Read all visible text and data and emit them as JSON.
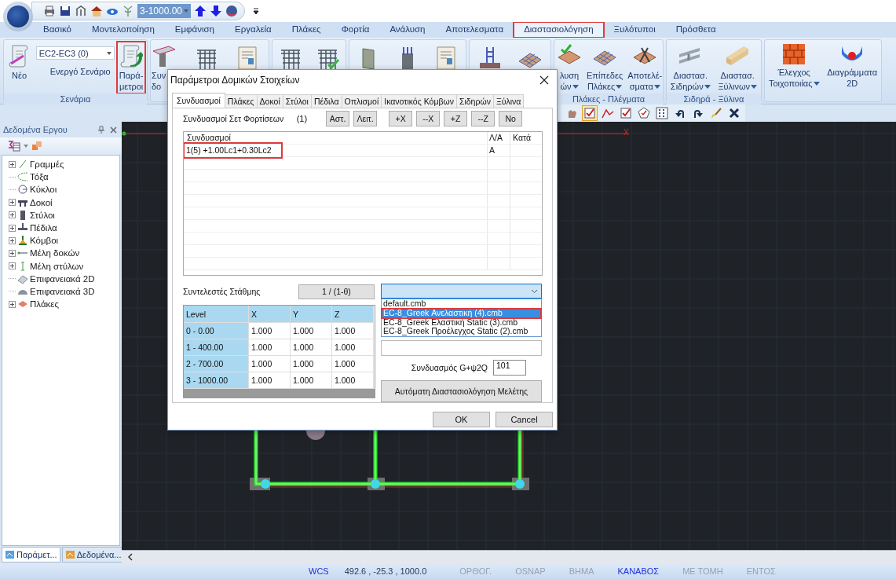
{
  "quick_access": {
    "level_combo": "3-1000.00"
  },
  "menu_tabs": [
    {
      "label": "Βασικό",
      "selected": false,
      "highlighted": false
    },
    {
      "label": "Μοντελοποίηση",
      "selected": false,
      "highlighted": false
    },
    {
      "label": "Εμφάνιση",
      "selected": false,
      "highlighted": false
    },
    {
      "label": "Εργαλεία",
      "selected": false,
      "highlighted": false
    },
    {
      "label": "Πλάκες",
      "selected": false,
      "highlighted": false
    },
    {
      "label": "Φορτία",
      "selected": false,
      "highlighted": false
    },
    {
      "label": "Ανάλυση",
      "selected": false,
      "highlighted": false
    },
    {
      "label": "Αποτελεσματα",
      "selected": false,
      "highlighted": false
    },
    {
      "label": "Διαστασιολόγηση",
      "selected": true,
      "highlighted": true
    },
    {
      "label": "Ξυλότυποι",
      "selected": false,
      "highlighted": false
    },
    {
      "label": "Πρόσθετα",
      "selected": false,
      "highlighted": false
    }
  ],
  "ribbon": {
    "groups": [
      {
        "label": "Σενάρια",
        "items": [
          {
            "kind": "large",
            "lines": [
              "Νέο"
            ],
            "dropdown": false,
            "highlighted": false
          },
          {
            "kind": "combo",
            "value": "EC2-EC3  (0)",
            "caption": "Ενεργό Σενάριο"
          },
          {
            "kind": "large",
            "lines": [
              "Παρά-",
              "μετροι"
            ],
            "dropdown": false,
            "highlighted": true
          }
        ]
      },
      {
        "items": [
          {
            "kind": "large",
            "lines": [
              "Συν",
              "δο"
            ],
            "dropdown": false,
            "highlighted": false
          },
          {
            "kind": "icon"
          },
          {
            "kind": "icon"
          }
        ]
      },
      {
        "items": [
          {
            "kind": "icon"
          },
          {
            "kind": "icon"
          }
        ]
      },
      {
        "items": [
          {
            "kind": "icon"
          },
          {
            "kind": "icon"
          },
          {
            "kind": "icon"
          }
        ]
      },
      {
        "items": [
          {
            "kind": "icon"
          },
          {
            "kind": "icon"
          }
        ]
      },
      {
        "label": "Πλάκες - Πλέγματα",
        "items": [
          {
            "kind": "large",
            "lines": [
              "λυση",
              "ών"
            ],
            "dropdown": true,
            "highlighted": false
          },
          {
            "kind": "large",
            "lines": [
              "Επίπεδες",
              "Πλάκες"
            ],
            "dropdown": true,
            "highlighted": false
          },
          {
            "kind": "large",
            "lines": [
              "Αποτελέ-",
              "σματα"
            ],
            "dropdown": true,
            "highlighted": false
          }
        ]
      },
      {
        "label": "Σιδηρά - Ξύλινα",
        "items": [
          {
            "kind": "large",
            "lines": [
              "Διαστασ.",
              "Σιδηρών"
            ],
            "dropdown": true,
            "highlighted": false
          },
          {
            "kind": "large",
            "lines": [
              "Διαστασ.",
              "Ξύλινων"
            ],
            "dropdown": true,
            "highlighted": false
          }
        ]
      },
      {
        "items": [
          {
            "kind": "large",
            "lines": [
              "Έλεγχος",
              "Τοιχοποιίας"
            ],
            "dropdown": true,
            "highlighted": false
          },
          {
            "kind": "large",
            "lines": [
              "Διαγράμματα",
              "2D"
            ],
            "dropdown": false,
            "highlighted": false
          }
        ]
      }
    ]
  },
  "toolbar": [
    {
      "pressed": false
    },
    {
      "pressed": true
    },
    {
      "pressed": false
    },
    {
      "pressed": false
    },
    {
      "pressed": false
    },
    {
      "pressed": false
    },
    {
      "pressed": false
    },
    {
      "pressed": false
    },
    {
      "pressed": false
    },
    {
      "pressed": false
    }
  ],
  "sidebar": {
    "title": "Δεδομένα Εργου",
    "items": [
      {
        "label": "Γραμμές",
        "kind": "group"
      },
      {
        "label": "Τόξα",
        "kind": "leaf"
      },
      {
        "label": "Κύκλοι",
        "kind": "leaf"
      },
      {
        "label": "Δοκοί",
        "kind": "group"
      },
      {
        "label": "Στύλοι",
        "kind": "group"
      },
      {
        "label": "Πέδιλα",
        "kind": "group"
      },
      {
        "label": "Κόμβοι",
        "kind": "group"
      },
      {
        "label": "Μέλη δοκών",
        "kind": "group"
      },
      {
        "label": "Μέλη στύλων",
        "kind": "group"
      },
      {
        "label": "Επιφανειακά 2D",
        "kind": "leaf"
      },
      {
        "label": "Επιφανειακά 3D",
        "kind": "leaf"
      },
      {
        "label": "Πλάκες",
        "kind": "group"
      }
    ],
    "bottom_tabs": [
      {
        "label": "Παράμετ...",
        "selected": true
      },
      {
        "label": "Δεδομένα...",
        "selected": false
      }
    ]
  },
  "canvas": {
    "axis_label": "X"
  },
  "dialog": {
    "title": "Παράμετροι Δομικών Στοιχείων",
    "tabs": [
      {
        "label": "Συνδυασμοί",
        "selected": true
      },
      {
        "label": "Πλάκες",
        "selected": false
      },
      {
        "label": "Δοκοί",
        "selected": false
      },
      {
        "label": "Στύλοι",
        "selected": false
      },
      {
        "label": "Πέδιλα",
        "selected": false
      },
      {
        "label": "Οπλισμοί",
        "selected": false
      },
      {
        "label": "Ικανοτικός Κόμβων",
        "selected": false
      },
      {
        "label": "Σιδηρών",
        "selected": false
      },
      {
        "label": "Ξύλινα",
        "selected": false
      }
    ],
    "load_sets": {
      "label": "Συνδυασμοί Σετ Φορτίσεων",
      "count": "(1)",
      "buttons": [
        "Αστ.",
        "Λειτ.",
        "+X",
        "--X",
        "+Z",
        "--Z",
        "No"
      ]
    },
    "combinations": {
      "columns": [
        "Συνδυασμοί",
        "Λ/Α",
        "Κατά"
      ],
      "rows": [
        {
          "formula": "1(5) +1.00Lc1+0.30Lc2",
          "type": "A",
          "highlighted": true
        }
      ]
    },
    "level_factors": {
      "label": "Συντελεστές Στάθμης",
      "button": "1 / (1-θ)",
      "columns": [
        "Level",
        "X",
        "Y",
        "Z"
      ],
      "rows": [
        [
          "0 - 0.00",
          "1.000",
          "1.000",
          "1.000"
        ],
        [
          "1 - 400.00",
          "1.000",
          "1.000",
          "1.000"
        ],
        [
          "2 - 700.00",
          "1.000",
          "1.000",
          "1.000"
        ],
        [
          "3 - 1000.00",
          "1.000",
          "1.000",
          "1.000"
        ]
      ]
    },
    "file_dropdown": {
      "expanded": true,
      "options": [
        {
          "label": "default.cmb",
          "selected": false,
          "highlighted": false
        },
        {
          "label": "EC-8_Greek Ανελαστική (4).cmb",
          "selected": true,
          "highlighted": true
        },
        {
          "label": "EC-8_Greek Ελαστική Static (3).cmb",
          "selected": false,
          "highlighted": false
        },
        {
          "label": "EC-8_Greek Προέλεγχος Static (2).cmb",
          "selected": false,
          "highlighted": false
        }
      ]
    },
    "g_psi": {
      "label": "Συνδυασμός G+ψ2Q",
      "value": "101"
    },
    "auto_button": "Αυτόματη Διαστασιολόγηση Μελέτης",
    "buttons": [
      "OK",
      "Cancel"
    ]
  },
  "status_bar": {
    "coordinates": "492.6 , -25.3 , 1000.0",
    "toggles": [
      {
        "label": "WCS",
        "on": true
      },
      {
        "label": "ΟΡΘΟΓ.",
        "on": false
      },
      {
        "label": "OSNAP",
        "on": false
      },
      {
        "label": "ΒΗΜΑ",
        "on": false
      },
      {
        "label": "ΚΑΝΑΒΟΣ",
        "on": true
      },
      {
        "label": "ΜΕ ΤΟΜΗ",
        "on": false
      },
      {
        "label": "ΕΝΤΟΣ",
        "on": false
      }
    ]
  }
}
